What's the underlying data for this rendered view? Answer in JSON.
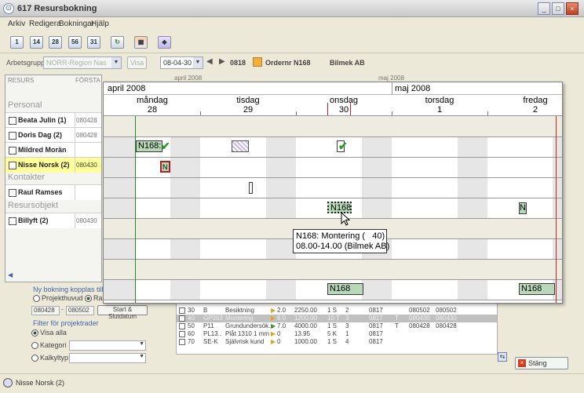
{
  "window": {
    "title": "617 Resursbokning",
    "controls": [
      "_",
      "□",
      "×"
    ]
  },
  "menu": [
    "Arkiv",
    "Redigera",
    "Bokningar",
    "Hjälp"
  ],
  "toolbar": {
    "buttons": [
      "1",
      "14",
      "28",
      "56",
      "31",
      "refresh",
      "calendar",
      "eraser"
    ]
  },
  "filter": {
    "arbetsgrupp_label": "Arbetsgrupp",
    "arbetsgrupp_value": "NORR-Region Nas",
    "visa_label": "Visa",
    "date_value": "08-04-30",
    "week": "0818",
    "order_label": "Ordernr N168",
    "customer": "Bilmek AB"
  },
  "left_panel": {
    "headers": {
      "resurs": "RESURS",
      "forsta": "FÖRSTA",
      "extra1": "1.0 %",
      "extra2": "% %-1"
    },
    "groups": [
      {
        "label": "Personal",
        "items": [
          {
            "name": "Beata Julin (1)",
            "date": "080428"
          },
          {
            "name": "Doris Dag (2)",
            "date": "080428"
          },
          {
            "name": "Mildred Morän",
            "date": ""
          },
          {
            "name": "Nisse Norsk (2)",
            "date": "080430"
          }
        ]
      },
      {
        "label": "Kontakter",
        "items": [
          {
            "name": "Raul Ramses",
            "date": ""
          }
        ]
      },
      {
        "label": "Resursobjekt",
        "items": [
          {
            "name": "Billyft (2)",
            "date": "080430"
          }
        ]
      }
    ]
  },
  "bg_header": {
    "a": "april 2008",
    "b": "maj 2008"
  },
  "bottom_left": {
    "koppling_title": "Ny bokning kopplas till",
    "opt_projekthuvud": "Projekthuvud",
    "opt_ra": "Ra",
    "from": "080428",
    "to": "080502",
    "start_button": "Start & Slutdatum",
    "filter_title": "Filter för projektrader",
    "opt_visa_alla": "Visa alla",
    "opt_kategori": "Kategori",
    "opt_kalkyltyp": "Kalkyltyp"
  },
  "tasks": [
    {
      "num": "30",
      "code": "B",
      "desc": "Besiktning",
      "q": "2.0",
      "amt": "2250.00",
      "u": "1 S",
      "n": "2",
      "w": "0817",
      "f": "",
      "d1": "080502",
      "d2": "080502",
      "hl": false
    },
    {
      "num": "40",
      "code": "GP003",
      "desc": "Montering",
      "q": "6.0",
      "amt": "1200.00",
      "u": "10 T",
      "n": "3",
      "w": "0817",
      "f": "T",
      "d1": "080430",
      "d2": "080430",
      "hl": true
    },
    {
      "num": "50",
      "code": "P11",
      "desc": "Grundundersök...",
      "q": "7.0",
      "amt": "4000.00",
      "u": "1 S",
      "n": "3",
      "w": "0817",
      "f": "T",
      "d1": "080428",
      "d2": "080428",
      "hl": false
    },
    {
      "num": "60",
      "code": "PL13..",
      "desc": "Plåt 1310 1 mm",
      "q": "0",
      "amt": "13.95",
      "u": "5 K",
      "n": "1",
      "w": "0817",
      "f": "",
      "d1": "",
      "d2": "",
      "hl": false
    },
    {
      "num": "70",
      "code": "SE-K",
      "desc": "Självrisk kund",
      "q": "0",
      "amt": "1000.00",
      "u": "1 S",
      "n": "4",
      "w": "0817",
      "f": "",
      "d1": "",
      "d2": "",
      "hl": false
    }
  ],
  "close_button": "Stäng",
  "status": {
    "user": "Nisse Norsk (2)"
  },
  "schedule": {
    "months": [
      "april 2008",
      "maj 2008"
    ],
    "days": [
      {
        "name": "måndag",
        "num": "28"
      },
      {
        "name": "tisdag",
        "num": "29"
      },
      {
        "name": "onsdag",
        "num": "30"
      },
      {
        "name": "torsdag",
        "num": "1"
      },
      {
        "name": "fredag",
        "num": "2"
      }
    ],
    "bars": {
      "b1": "N168:",
      "b2": "N",
      "b3": "N168",
      "b4": "N",
      "b5": "N168",
      "b6": "N168"
    },
    "tooltip": {
      "line1": "N168: Montering (   40)",
      "line2": "08.00-14.00 (Bilmek AB)"
    }
  },
  "colors": {
    "accent": "#b8d8b8",
    "selection": "#ffff99",
    "lane": "#eeebe0",
    "today_line": "#cc2222",
    "start_line": "#2a8a2a"
  }
}
